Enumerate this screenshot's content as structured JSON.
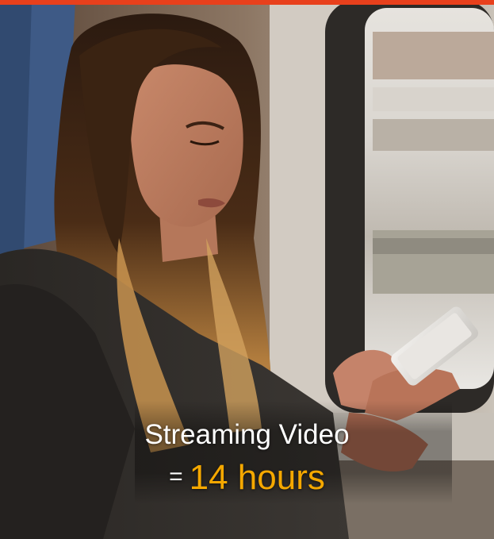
{
  "caption": {
    "line1": "Streaming Video",
    "equals": "=",
    "highlight": "14 hours"
  },
  "colors": {
    "accent_bar": "#e8401c",
    "highlight": "#f5a800",
    "caption_text": "#ffffff"
  },
  "image": {
    "subject": "photo-woman-on-train-with-phone"
  }
}
